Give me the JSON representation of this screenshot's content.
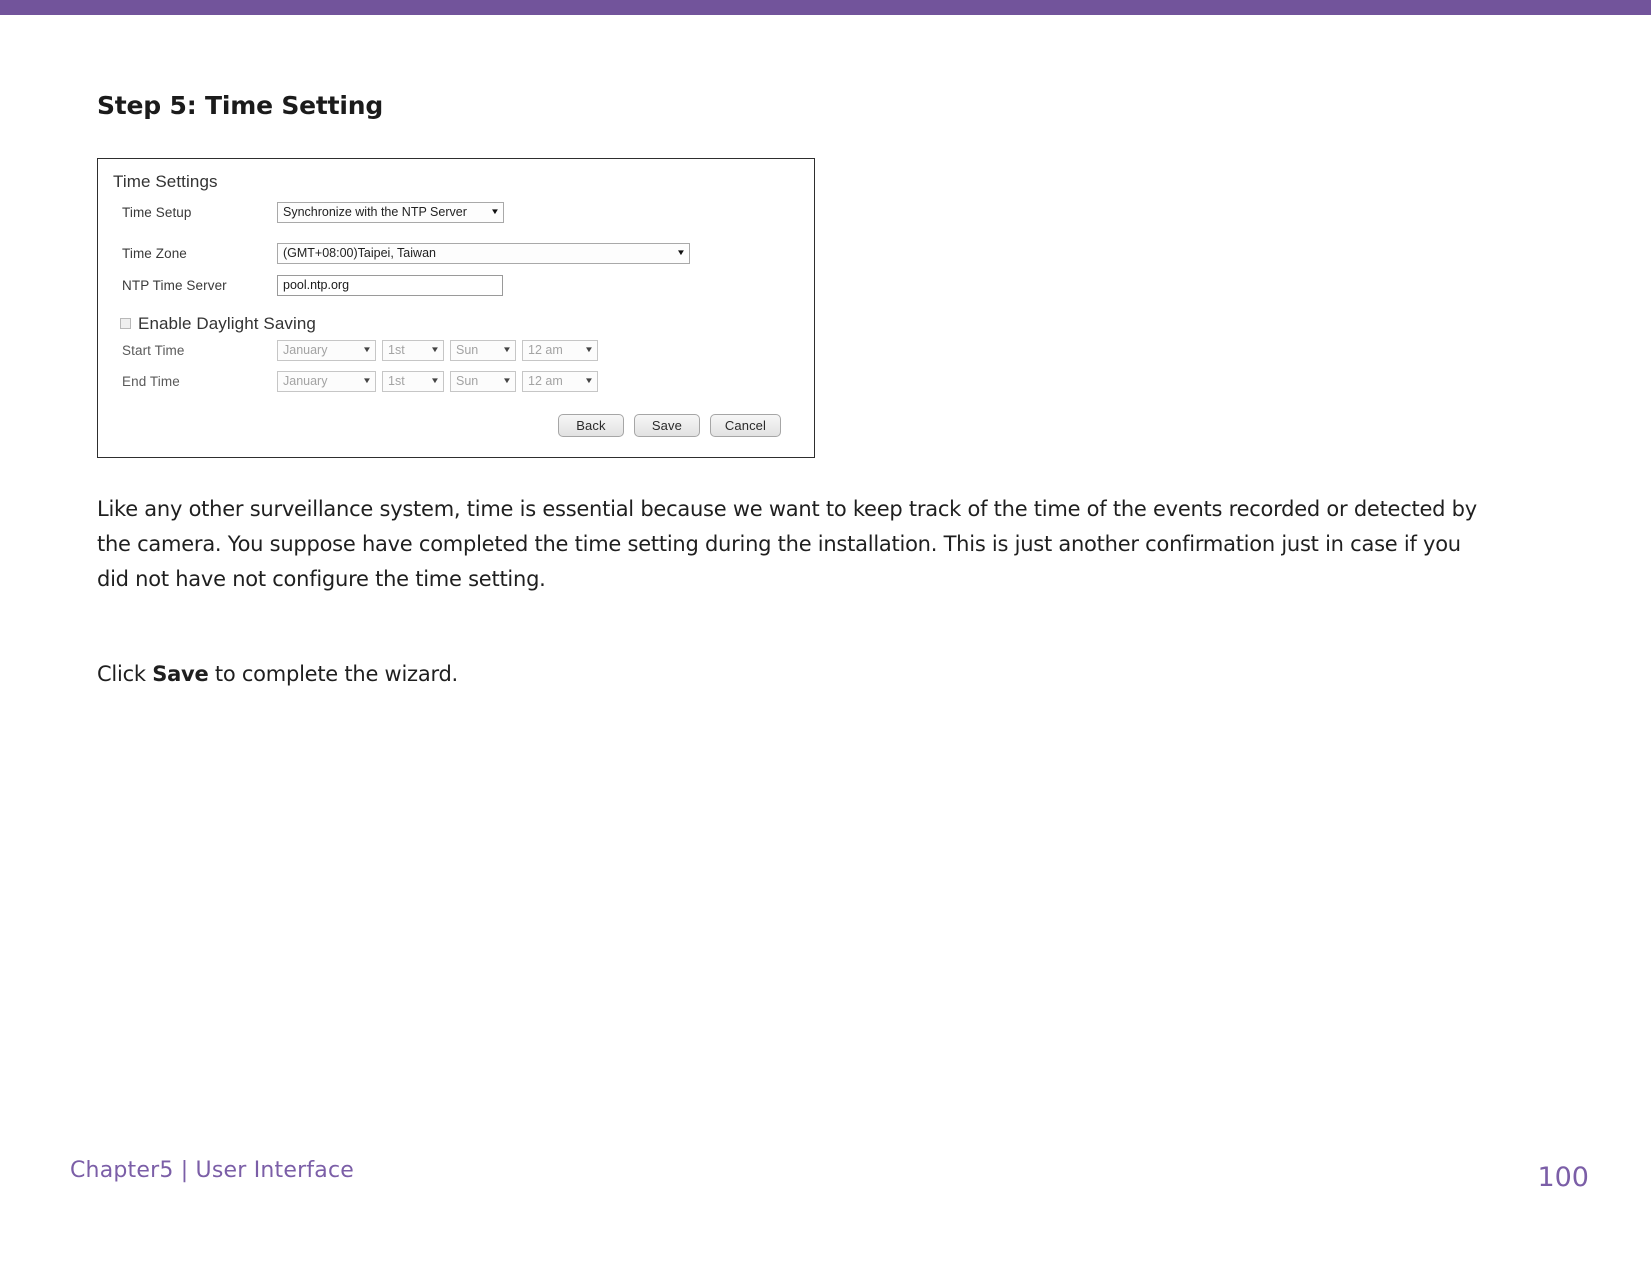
{
  "theme": {
    "accent": "#72549b",
    "footer_text_color": "#7b5ea7"
  },
  "heading": "Step 5: Time Setting",
  "screenshot": {
    "panel_title": "Time Settings",
    "rows": [
      {
        "label": "Time Setup",
        "value": "Synchronize with the NTP Server",
        "control": "select"
      },
      {
        "label": "Time Zone",
        "value": "(GMT+08:00)Taipei, Taiwan",
        "control": "select"
      },
      {
        "label": "NTP Time Server",
        "value": "pool.ntp.org",
        "control": "text"
      }
    ],
    "daylight_saving": {
      "label": "Enable Daylight Saving",
      "checked": false
    },
    "start_time": {
      "label": "Start Time",
      "month": "January",
      "ordinal": "1st",
      "weekday": "Sun",
      "hour": "12 am"
    },
    "end_time": {
      "label": "End Time",
      "month": "January",
      "ordinal": "1st",
      "weekday": "Sun",
      "hour": "12 am"
    },
    "buttons": {
      "back": "Back",
      "save": "Save",
      "cancel": "Cancel"
    },
    "dropdown_arrow": "▼"
  },
  "body": {
    "paragraph1": "Like any other surveillance system, time is essential because we want to keep track of the time of the events recorded or detected by the camera. You suppose have completed the time setting during the installation. This is just another confirmation just in case if you did not have not configure the time setting.",
    "paragraph2_prefix": "Click ",
    "paragraph2_bold": "Save",
    "paragraph2_suffix": " to complete the wizard."
  },
  "footer": {
    "chapter": "Chapter5  |  User Interface",
    "page_number": "100"
  }
}
